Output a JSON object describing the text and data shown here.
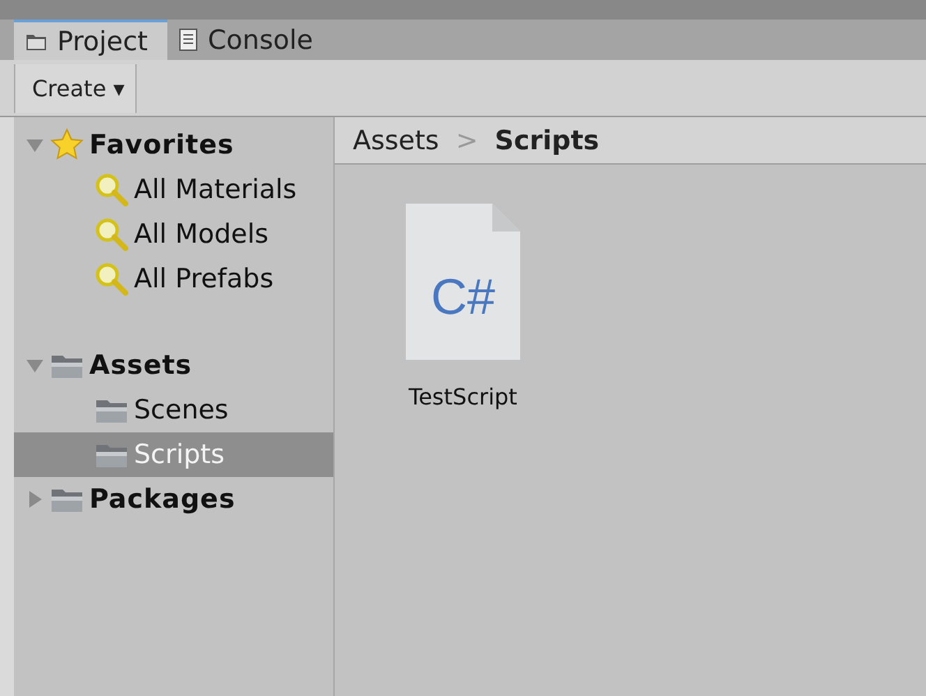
{
  "tabs": [
    {
      "label": "Project",
      "kind": "folder",
      "selected": true
    },
    {
      "label": "Console",
      "kind": "log",
      "selected": false
    }
  ],
  "toolbar": {
    "create_button": "Create ▾"
  },
  "tree": [
    {
      "label": "Favorites",
      "kind": "star",
      "expanded": true,
      "selected": false,
      "children": [
        {
          "label": "All Materials",
          "kind": "search",
          "selected": false
        },
        {
          "label": "All Models",
          "kind": "search",
          "selected": false
        },
        {
          "label": "All Prefabs",
          "kind": "search",
          "selected": false
        }
      ]
    },
    {
      "label": "Assets",
      "kind": "folder",
      "expanded": true,
      "selected": false,
      "children": [
        {
          "label": "Scenes",
          "kind": "folder",
          "selected": false
        },
        {
          "label": "Scripts",
          "kind": "folder",
          "selected": true
        }
      ]
    },
    {
      "label": "Packages",
      "kind": "folder",
      "expanded": false,
      "selected": false
    }
  ],
  "breadcrumb": [
    {
      "label": "Assets",
      "current": false
    },
    {
      "label": "Scripts",
      "current": true
    }
  ],
  "breadcrumb_separator": ">",
  "assets": [
    {
      "name": "TestScript",
      "kind": "csharp",
      "badge": "C#"
    }
  ]
}
